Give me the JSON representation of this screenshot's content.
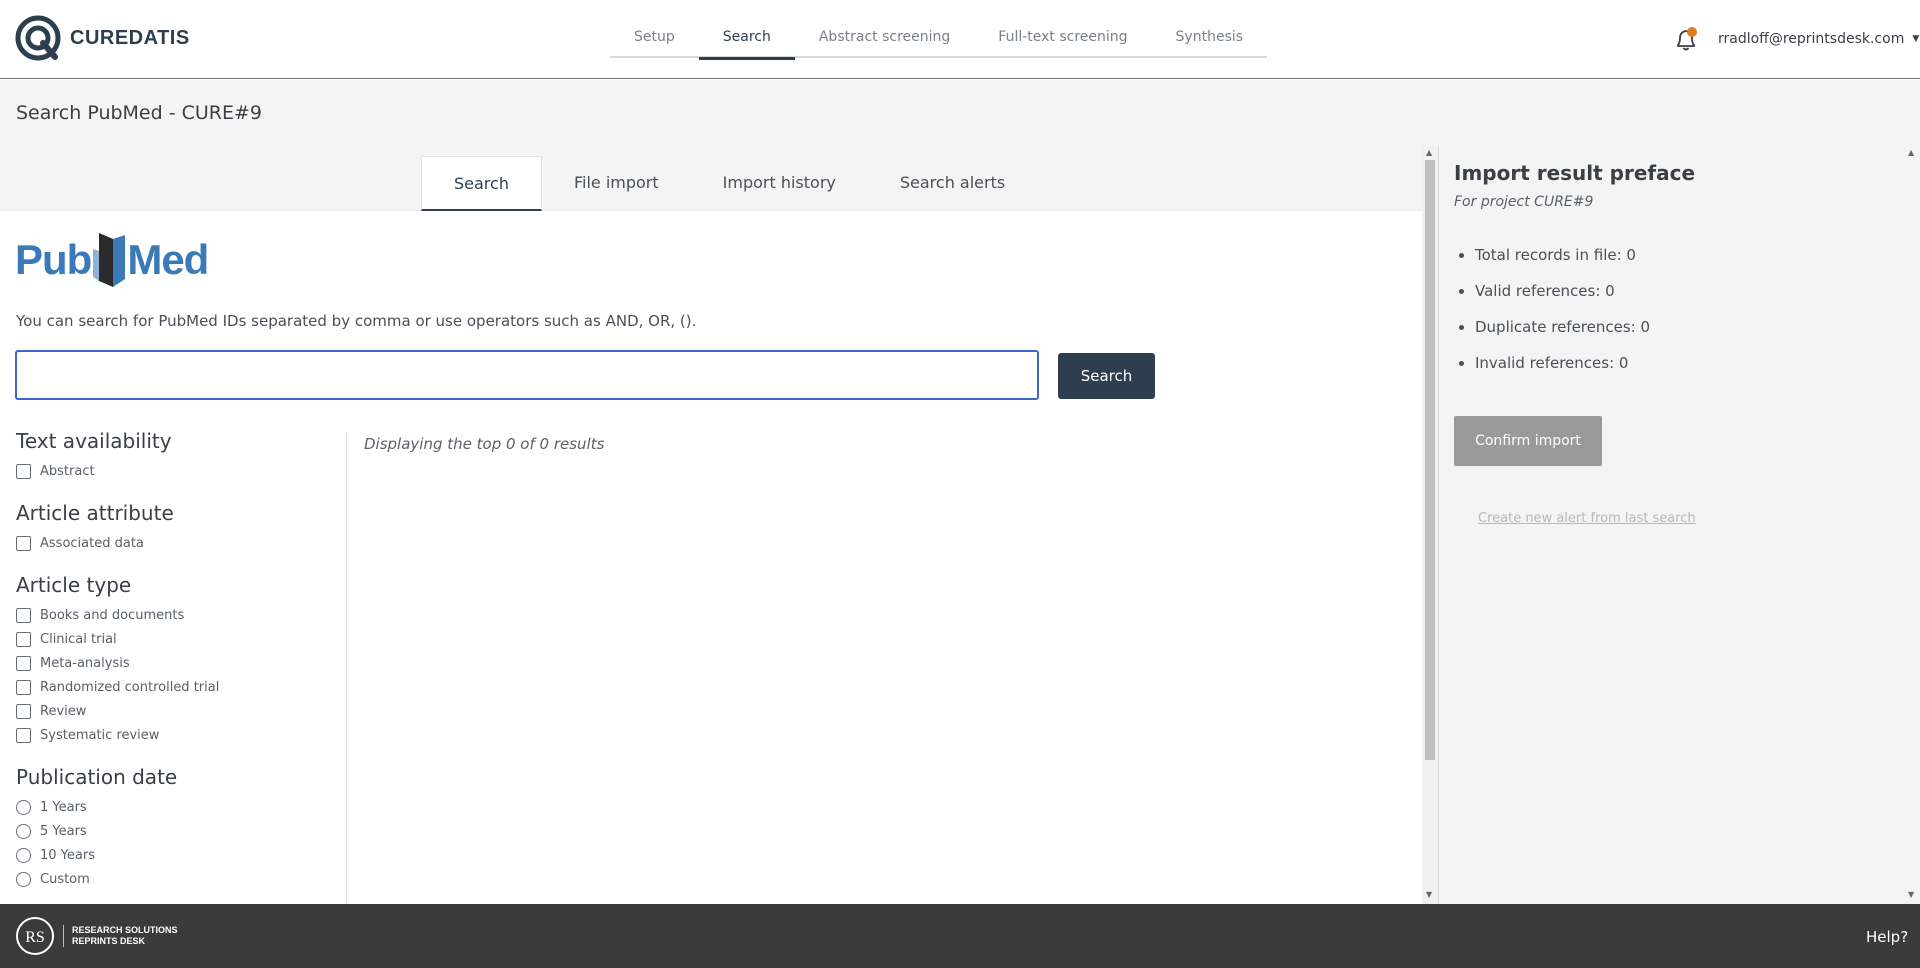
{
  "brand": {
    "name": "CUREDATIS"
  },
  "nav": {
    "items": [
      {
        "label": "Setup"
      },
      {
        "label": "Search"
      },
      {
        "label": "Abstract screening"
      },
      {
        "label": "Full-text screening"
      },
      {
        "label": "Synthesis"
      }
    ],
    "active_index": 1
  },
  "user": {
    "email": "rradloff@reprintsdesk.com"
  },
  "colors": {
    "primary": "#2e3e4f",
    "notification_dot": "#e07a1f",
    "input_focus": "#3a68c8",
    "pubmed_blue": "#3a7ab8"
  },
  "page": {
    "title": "Search PubMed - CURE#9"
  },
  "tabs": {
    "items": [
      {
        "label": "Search"
      },
      {
        "label": "File import"
      },
      {
        "label": "Import history"
      },
      {
        "label": "Search alerts"
      }
    ]
  },
  "pubmed": {
    "logo_left": "Pub",
    "logo_right": "Med",
    "hint": "You can search for PubMed IDs separated by comma or use operators such as AND, OR, ().",
    "search_value": "",
    "search_button": "Search"
  },
  "filters": {
    "text_availability": {
      "heading": "Text availability",
      "options": [
        "Abstract"
      ]
    },
    "article_attribute": {
      "heading": "Article attribute",
      "options": [
        "Associated data"
      ]
    },
    "article_type": {
      "heading": "Article type",
      "options": [
        "Books and documents",
        "Clinical trial",
        "Meta-analysis",
        "Randomized controlled trial",
        "Review",
        "Systematic review"
      ]
    },
    "publication_date": {
      "heading": "Publication date",
      "options": [
        "1 Years",
        "5 Years",
        "10 Years",
        "Custom"
      ]
    }
  },
  "results": {
    "summary": "Displaying the top 0 of 0 results"
  },
  "side": {
    "title": "Import result preface",
    "subtitle": "For project CURE#9",
    "stats": [
      "Total records in file: 0",
      "Valid references: 0",
      "Duplicate references: 0",
      "Invalid references: 0"
    ],
    "confirm_button": "Confirm import",
    "alert_link": "Create new alert from last search"
  },
  "footer": {
    "logo_line1": "RESEARCH SOLUTIONS",
    "logo_line2": "REPRINTS DESK",
    "help": "Help?"
  }
}
